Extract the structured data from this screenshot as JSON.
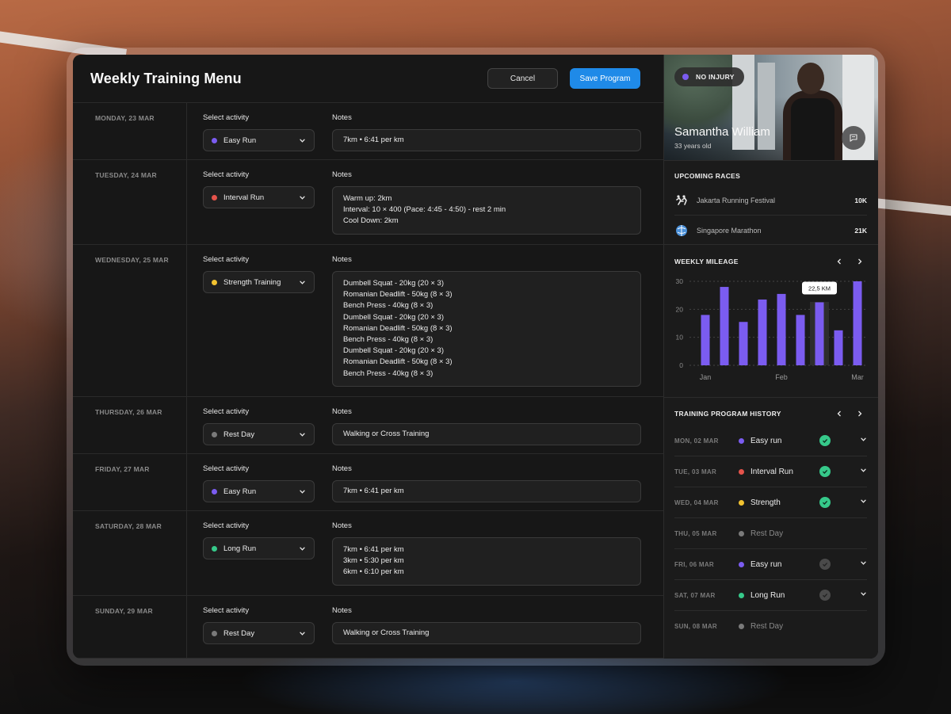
{
  "header": {
    "title": "Weekly Training Menu",
    "cancel_label": "Cancel",
    "save_label": "Save Program"
  },
  "labels": {
    "select_activity": "Select activity",
    "notes": "Notes"
  },
  "activity_colors": {
    "Easy Run": "#7b5cf0",
    "Interval Run": "#e5534b",
    "Strength Training": "#f2c230",
    "Rest Day": "#7a7a7a",
    "Long Run": "#36c98a"
  },
  "days": [
    {
      "date": "MONDAY, 23 MAR",
      "activity": "Easy Run",
      "color": "#7b5cf0",
      "notes": [
        "7km  •  6:41 per km"
      ]
    },
    {
      "date": "TUESDAY, 24 MAR",
      "activity": "Interval Run",
      "color": "#e5534b",
      "notes": [
        "Warm up: 2km",
        "Interval: 10 × 400 (Pace: 4:45 - 4:50) - rest 2 min",
        "Cool Down: 2km"
      ]
    },
    {
      "date": "WEDNESDAY, 25 MAR",
      "activity": "Strength Training",
      "color": "#f2c230",
      "notes": [
        "Dumbell Squat - 20kg (20 × 3)",
        "Romanian Deadlift - 50kg (8 × 3)",
        "Bench Press - 40kg (8 × 3)",
        "Dumbell Squat - 20kg (20 × 3)",
        "Romanian Deadlift - 50kg (8 × 3)",
        "Bench Press - 40kg (8 × 3)",
        "Dumbell Squat - 20kg (20 × 3)",
        "Romanian Deadlift - 50kg (8 × 3)",
        "Bench Press - 40kg (8 × 3)"
      ]
    },
    {
      "date": "THURSDAY, 26 MAR",
      "activity": "Rest Day",
      "color": "#7a7a7a",
      "notes": [
        "Walking or Cross Training"
      ]
    },
    {
      "date": "FRIDAY, 27 MAR",
      "activity": "Easy Run",
      "color": "#7b5cf0",
      "notes": [
        "7km  •  6:41 per km"
      ]
    },
    {
      "date": "SATURDAY, 28 MAR",
      "activity": "Long Run",
      "color": "#36c98a",
      "notes": [
        "7km  •  6:41 per km",
        "3km  •  5:30 per km",
        "6km  •  6:10 per km"
      ]
    },
    {
      "date": "SUNDAY, 29 MAR",
      "activity": "Rest Day",
      "color": "#7a7a7a",
      "notes": [
        "Walking or Cross Training"
      ]
    }
  ],
  "profile": {
    "status_badge": "NO INJURY",
    "status_color": "#7b5cf0",
    "name": "Samantha William",
    "age": "33 years old"
  },
  "upcoming_races": {
    "title": "UPCOMING RACES",
    "items": [
      {
        "name": "Jakarta Running Festival",
        "distance": "10K",
        "icon": "runner-logo-icon"
      },
      {
        "name": "Singapore Marathon",
        "distance": "21K",
        "icon": "globe-logo-icon"
      }
    ]
  },
  "weekly_mileage": {
    "title": "WEEKLY MILEAGE",
    "tooltip": "22,5 KM"
  },
  "chart_data": {
    "type": "bar",
    "categories": [
      "1",
      "2",
      "3",
      "4",
      "5",
      "6",
      "7",
      "8",
      "9",
      "10"
    ],
    "values": [
      18,
      28,
      15.5,
      23.5,
      25.5,
      18,
      22.5,
      12.5,
      30
    ],
    "x_tick_labels": [
      "Jan",
      "Feb",
      "Mar"
    ],
    "ylim": [
      0,
      30
    ],
    "yticks": [
      0,
      10,
      20,
      30
    ],
    "highlight_index": 6,
    "bar_color": "#7b5cf0",
    "grid": true
  },
  "history": {
    "title": "TRAINING PROGRAM HISTORY",
    "items": [
      {
        "date": "MON, 02 MAR",
        "activity": "Easy run",
        "color": "#7b5cf0",
        "status": "done",
        "expandable": true
      },
      {
        "date": "TUE, 03 MAR",
        "activity": "Interval Run",
        "color": "#e5534b",
        "status": "done",
        "expandable": true
      },
      {
        "date": "WED, 04 MAR",
        "activity": "Strength",
        "color": "#f2c230",
        "status": "done",
        "expandable": true
      },
      {
        "date": "THU, 05 MAR",
        "activity": "Rest Day",
        "color": "#7a7a7a",
        "status": "rest",
        "expandable": false
      },
      {
        "date": "FRI, 06 MAR",
        "activity": "Easy run",
        "color": "#7b5cf0",
        "status": "pending",
        "expandable": true
      },
      {
        "date": "SAT, 07 MAR",
        "activity": "Long Run",
        "color": "#36c98a",
        "status": "pending",
        "expandable": true
      },
      {
        "date": "SUN, 08 MAR",
        "activity": "Rest Day",
        "color": "#7a7a7a",
        "status": "rest",
        "expandable": false
      }
    ]
  }
}
